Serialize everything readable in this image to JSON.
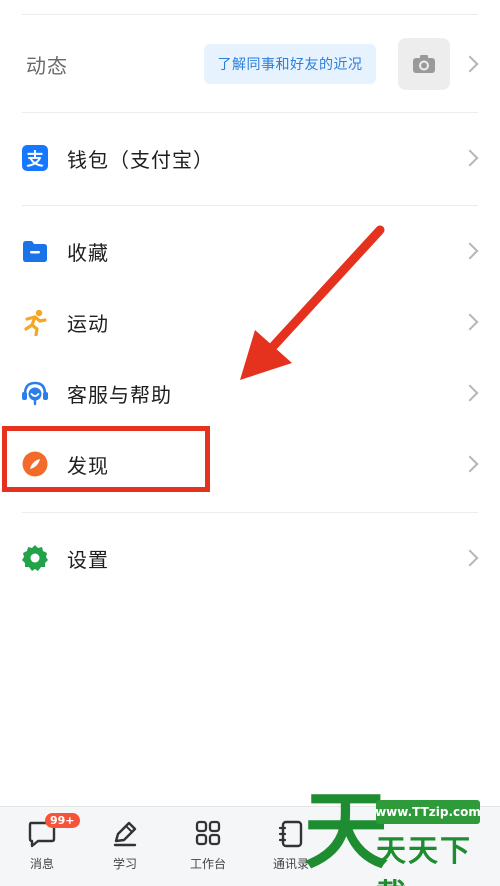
{
  "moments": {
    "label": "动态",
    "bubble_text": "了解同事和好友的近况",
    "camera_icon": "camera-icon"
  },
  "menu": [
    {
      "key": "wallet",
      "label": "钱包（支付宝）",
      "icon": "alipay-icon",
      "icon_color": "#1677ff"
    },
    {
      "key": "favorites",
      "label": "收藏",
      "icon": "folder-icon",
      "icon_color": "#1a73e8"
    },
    {
      "key": "sports",
      "label": "运动",
      "icon": "runner-icon",
      "icon_color": "#f5a623"
    },
    {
      "key": "support",
      "label": "客服与帮助",
      "icon": "headset-icon",
      "icon_color": "#2b7de9"
    },
    {
      "key": "discover",
      "label": "发现",
      "icon": "compass-icon",
      "icon_color": "#f26b2a"
    },
    {
      "key": "settings",
      "label": "设置",
      "icon": "gear-icon",
      "icon_color": "#22a34a"
    }
  ],
  "annotation": {
    "highlight_color": "#e5321e",
    "highlighted_item": "发现"
  },
  "tabbar": {
    "items": [
      {
        "label": "消息",
        "icon": "message-icon",
        "badge": "99+"
      },
      {
        "label": "学习",
        "icon": "pen-icon"
      },
      {
        "label": "工作台",
        "icon": "grid-icon"
      },
      {
        "label": "通讯录",
        "icon": "contacts-icon"
      }
    ]
  },
  "watermark": {
    "url": "www.TTzip.com",
    "text": "天天下載"
  }
}
